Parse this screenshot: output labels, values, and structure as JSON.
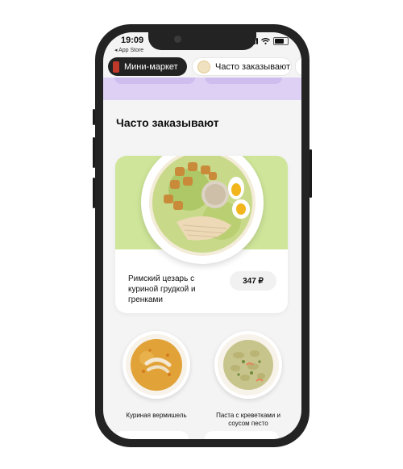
{
  "status": {
    "time": "19:09",
    "back_label": "◂ App Store"
  },
  "categories": [
    {
      "label": "Мини-маркет",
      "selected": true
    },
    {
      "label": "Часто заказывают",
      "selected": false
    }
  ],
  "section": {
    "title": "Часто заказывают"
  },
  "featured": {
    "name": "Римский цезарь с куриной грудкой и гренками",
    "price": "347 ₽"
  },
  "items": [
    {
      "name": "Куриная вермишель"
    },
    {
      "name": "Паста с креветками и соусом песто"
    }
  ],
  "colors": {
    "accent_band": "#ddd0f4",
    "featured_bg": "#cfe69a",
    "chip_dark": "#222222"
  }
}
